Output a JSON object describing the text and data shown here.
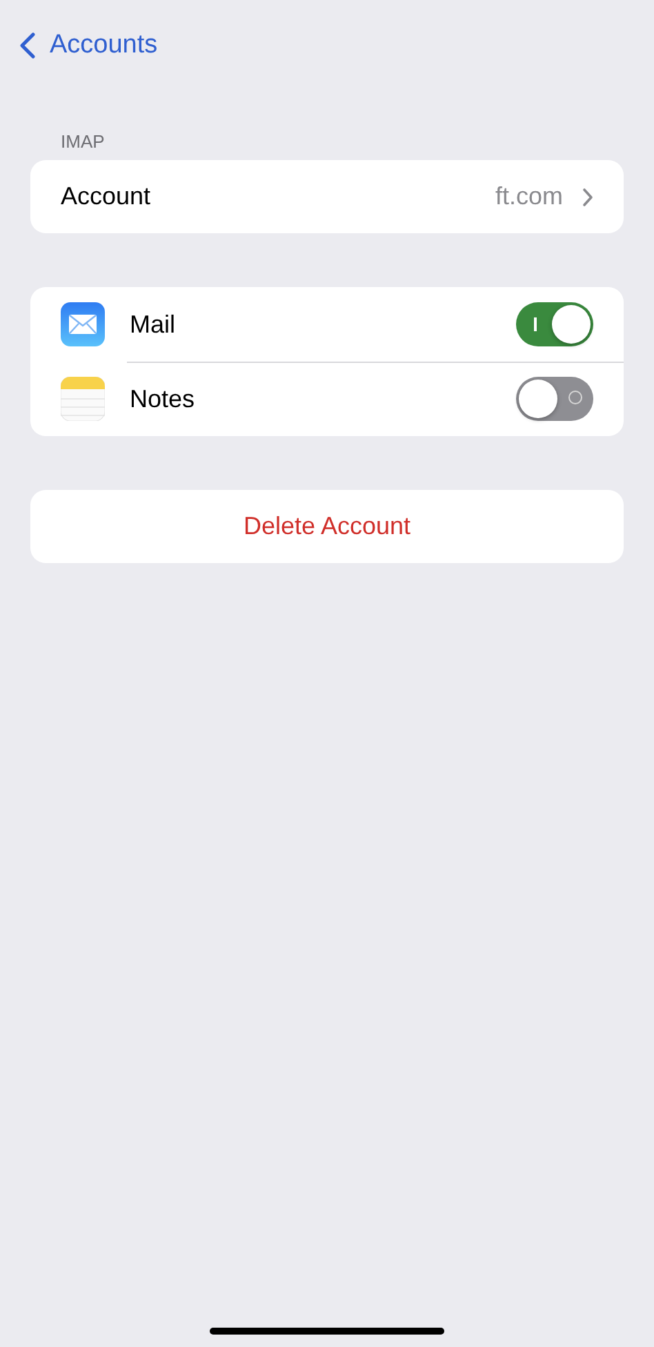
{
  "nav": {
    "back_label": "Accounts"
  },
  "account_section": {
    "header": "IMAP",
    "row": {
      "label": "Account",
      "value": "ft.com"
    }
  },
  "apps": [
    {
      "kind": "mail",
      "label": "Mail",
      "on": true
    },
    {
      "kind": "notes",
      "label": "Notes",
      "on": false
    }
  ],
  "delete_button": "Delete Account"
}
